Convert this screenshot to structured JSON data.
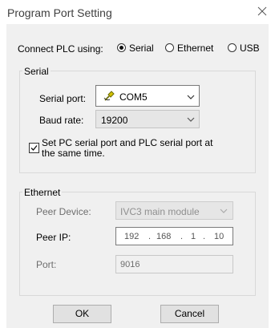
{
  "window": {
    "title": "Program Port Setting"
  },
  "connect": {
    "label": "Connect PLC using:",
    "options": [
      {
        "label": "Serial",
        "selected": true
      },
      {
        "label": "Ethernet",
        "selected": false
      },
      {
        "label": "USB",
        "selected": false
      }
    ]
  },
  "serial": {
    "title": "Serial",
    "port_label": "Serial port:",
    "port_value": "COM5",
    "baud_label": "Baud rate:",
    "baud_value": "19200",
    "sync_label_line1": "Set PC serial port and PLC serial port at",
    "sync_label_line2": "the same time.",
    "sync_checked": true
  },
  "ethernet": {
    "title": "Ethernet",
    "peer_device_label": "Peer Device:",
    "peer_device_value": "IVC3 main module",
    "peer_ip_label": "Peer IP:",
    "ip": [
      "192",
      "168",
      "1",
      "10"
    ],
    "port_label": "Port:",
    "port_value": "9016"
  },
  "buttons": {
    "ok": "OK",
    "cancel": "Cancel"
  },
  "colors": {
    "dialog_bg": "#f0f0f0",
    "titlebar_bg": "#ffffff",
    "group_border": "#d9d9d9"
  }
}
